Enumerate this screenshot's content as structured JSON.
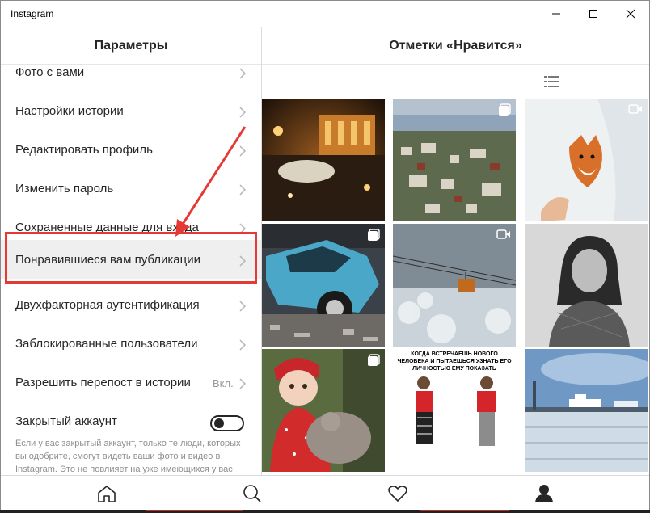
{
  "window": {
    "title": "Instagram",
    "controls": [
      "minimize",
      "maximize",
      "close"
    ]
  },
  "settings": {
    "header": "Параметры",
    "items": [
      {
        "label": "Фото с вами"
      },
      {
        "label": "Настройки истории"
      },
      {
        "label": "Редактировать профиль"
      },
      {
        "label": "Изменить пароль"
      },
      {
        "label": "Сохраненные данные для входа"
      },
      {
        "label": "Понравившиеся вам публикации",
        "highlighted": true
      },
      {
        "label": "Двухфакторная аутентификация"
      },
      {
        "label": "Заблокированные пользователи"
      },
      {
        "label": "Разрешить перепост в истории",
        "value": "Вкл."
      },
      {
        "label": "Закрытый аккаунт",
        "toggle": false
      }
    ],
    "private_note": "Если у вас закрытый аккаунт, только те люди, которых вы одобрите, смогут видеть ваши фото и видео в Instagram. Это не повлияет на уже имеющихся у вас"
  },
  "liked": {
    "header": "Отметки «Нравится»",
    "view_tabs": [
      {
        "icon": "grid-icon",
        "active": true
      },
      {
        "icon": "list-icon",
        "active": false
      }
    ],
    "tiles": [
      {
        "subject": "Night city square with illuminated building",
        "badge": ""
      },
      {
        "subject": "Aerial view of a city by the sea",
        "badge": "multiple-icon"
      },
      {
        "subject": "Fox running in snow",
        "badge": "video-icon"
      },
      {
        "subject": "Blue vintage car",
        "badge": "multiple-icon"
      },
      {
        "subject": "Cable car in winter fog",
        "badge": "video-icon"
      },
      {
        "subject": "Black and white portrait of a woman",
        "badge": ""
      },
      {
        "subject": "Baby in red with teddy bear",
        "badge": "multiple-icon"
      },
      {
        "subject": "Meme with two men",
        "badge": "",
        "caption": "КОГДА ВСТРЕЧАЕШЬ НОВОГО ЧЕЛОВЕКА И ПЫТАЕШЬСЯ УЗНАТЬ ЕГО ЛИЧНОСТЬЮ ЕМУ ПОКАЗАТЬ"
      },
      {
        "subject": "Ships on a calm bay",
        "badge": ""
      }
    ]
  },
  "bottom_nav": [
    {
      "icon": "home-icon"
    },
    {
      "icon": "search-icon"
    },
    {
      "icon": "heart-icon"
    },
    {
      "icon": "profile-icon",
      "active": true
    }
  ],
  "colors": {
    "highlight_box": "#e53935",
    "text": "#262626",
    "muted": "#8e8e8e",
    "active_tab": "#3897f0"
  }
}
